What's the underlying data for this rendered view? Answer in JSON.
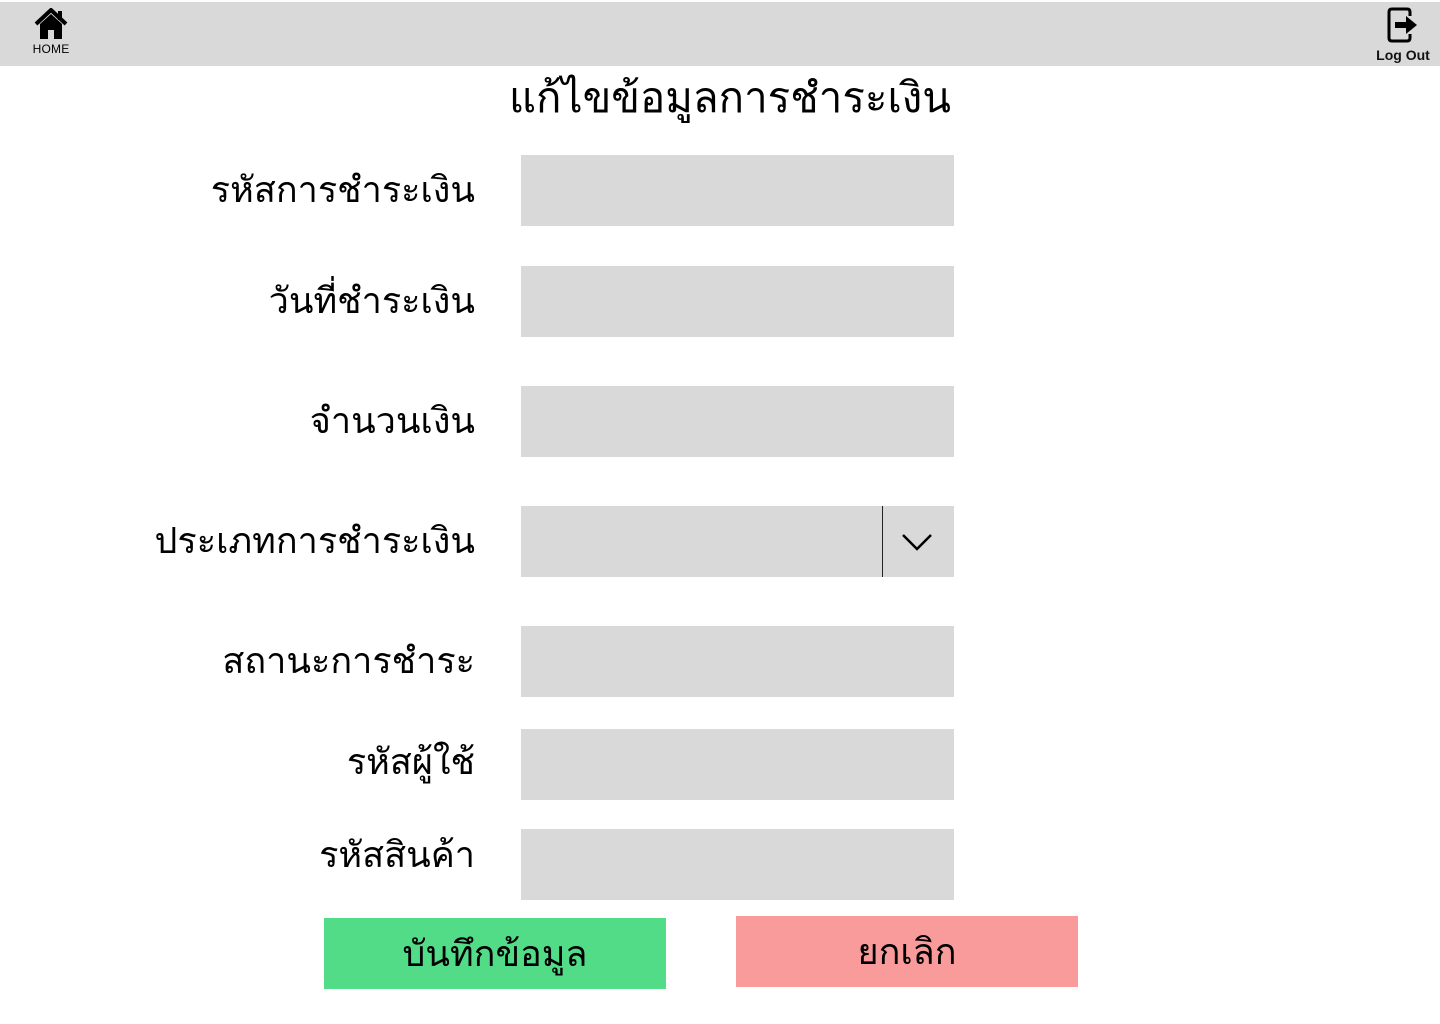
{
  "header": {
    "home_label": "HOME",
    "logout_label": "Log Out"
  },
  "page_title": "แก้ไขข้อมูลการชำระเงิน",
  "form": {
    "fields": [
      {
        "label": "รหัสการชำระเงิน",
        "value": ""
      },
      {
        "label": "วันที่ชำระเงิน",
        "value": ""
      },
      {
        "label": "จำนวนเงิน",
        "value": ""
      },
      {
        "label": "ประเภทการชำระเงิน",
        "selected": ""
      },
      {
        "label": "สถานะการชำระ",
        "value": ""
      },
      {
        "label": "รหัสผู้ใช้",
        "value": ""
      },
      {
        "label": "รหัสสินค้า",
        "value": ""
      }
    ]
  },
  "buttons": {
    "save_label": "บันทึกข้อมูล",
    "cancel_label": "ยกเลิก"
  },
  "colors": {
    "topbar": "#d9d9d9",
    "field_bg": "#d9d9d9",
    "save": "#53dc88",
    "cancel": "#f99b9b"
  }
}
